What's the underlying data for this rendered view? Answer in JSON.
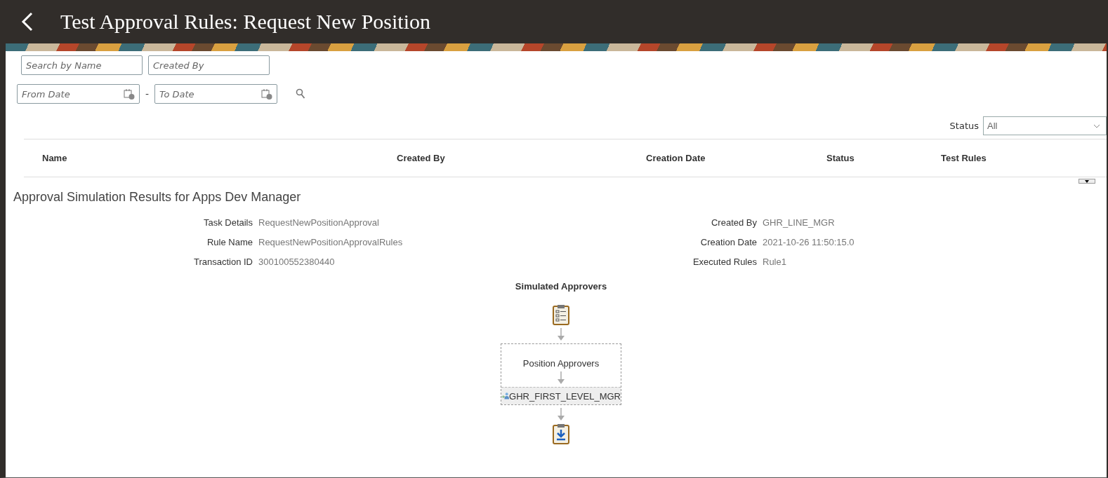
{
  "header": {
    "title": "Test Approval Rules: Request New Position"
  },
  "filters": {
    "name": {
      "placeholder": "Search by Name"
    },
    "created_by": {
      "placeholder": "Created By"
    },
    "from_date": {
      "placeholder": "From Date"
    },
    "separator": "-",
    "to_date": {
      "placeholder": "To Date"
    }
  },
  "status_filter": {
    "label": "Status",
    "value": "All"
  },
  "table": {
    "columns": [
      "Name",
      "Created By",
      "Creation Date",
      "Status",
      "Test Rules"
    ]
  },
  "results": {
    "title": "Approval Simulation Results for Apps Dev Manager",
    "details_left": [
      {
        "label": "Task Details",
        "value": "RequestNewPositionApproval"
      },
      {
        "label": "Rule Name",
        "value": "RequestNewPositionApprovalRules"
      },
      {
        "label": "Transaction ID",
        "value": "300100552380440"
      }
    ],
    "details_right": [
      {
        "label": "Created By",
        "value": "GHR_LINE_MGR"
      },
      {
        "label": "Creation Date",
        "value": "2021-10-26 11:50:15.0"
      },
      {
        "label": "Executed Rules",
        "value": "Rule1"
      }
    ],
    "diagram": {
      "title": "Simulated Approvers",
      "group": "Position Approvers",
      "approver": "GHR_FIRST_LEVEL_MGR"
    }
  }
}
